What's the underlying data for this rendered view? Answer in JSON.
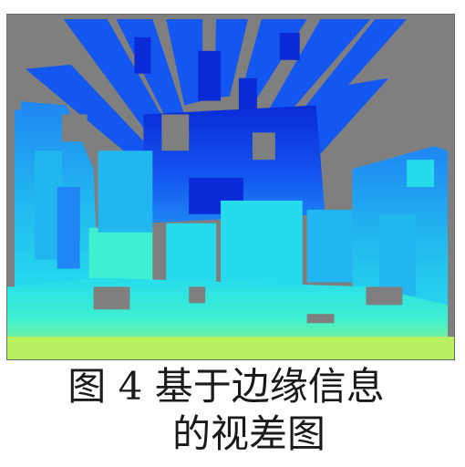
{
  "figure": {
    "background_color": "#7f7f7f",
    "colormap": [
      "#0a2bd6",
      "#1456f0",
      "#1e86f2",
      "#22b6f0",
      "#26dcec",
      "#3ef0d0",
      "#7bf29a",
      "#b8f060"
    ]
  },
  "caption": {
    "line1": "图 4 基于边缘信息",
    "line2": "的视差图"
  }
}
